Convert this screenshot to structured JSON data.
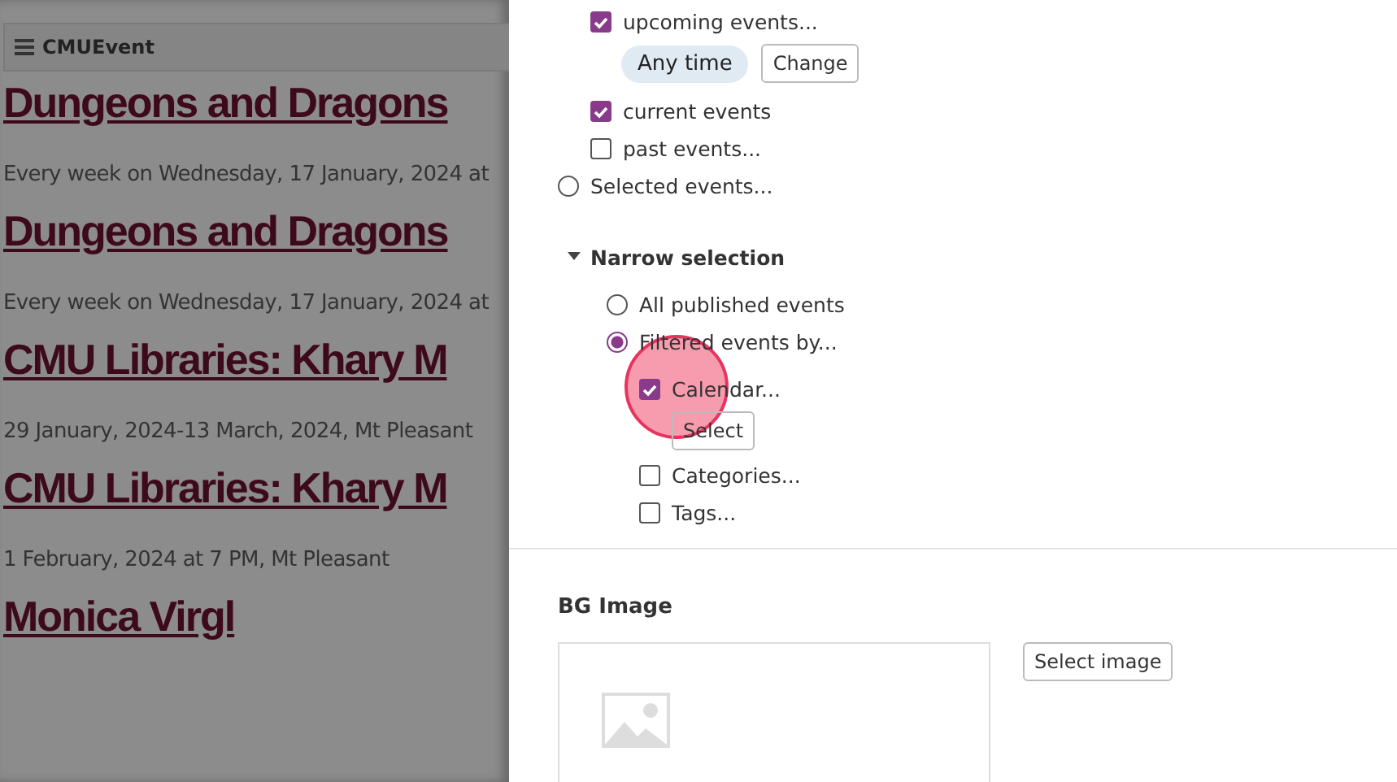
{
  "background_page": {
    "toolbar": {
      "title": "CMUEvent"
    },
    "events": [
      {
        "title": "Dungeons and Dragons",
        "date": "Every week on Wednesday, 17 January, 2024 at"
      },
      {
        "title": "Dungeons and Dragons",
        "date": "Every week on Wednesday, 17 January, 2024 at"
      },
      {
        "title": "CMU Libraries: Khary M",
        "date": "29 January, 2024-13 March, 2024, Mt Pleasant"
      },
      {
        "title": "CMU Libraries: Khary M",
        "date": "1 February, 2024 at 7 PM, Mt Pleasant"
      },
      {
        "title": "Monica Virgl"
      }
    ]
  },
  "panel": {
    "event_options": [
      {
        "kind": "checkbox",
        "label": "upcoming events...",
        "checked": true,
        "chip": "Any time",
        "button": "Change"
      },
      {
        "kind": "checkbox",
        "label": "current events",
        "checked": true
      },
      {
        "kind": "checkbox",
        "label": "past events...",
        "checked": false
      },
      {
        "kind": "radio",
        "label": "Selected events...",
        "selected": false
      }
    ],
    "narrow_selection": {
      "title": "Narrow selection",
      "expanded": true,
      "options": [
        {
          "label": "All published events",
          "selected": false
        },
        {
          "label": "Filtered events by...",
          "selected": true
        }
      ],
      "filters": [
        {
          "label": "Calendar...",
          "checked": true,
          "button": "Select"
        },
        {
          "label": "Categories...",
          "checked": false
        },
        {
          "label": "Tags...",
          "checked": false
        }
      ]
    },
    "bg_image": {
      "title": "BG Image",
      "button": "Select image"
    }
  }
}
